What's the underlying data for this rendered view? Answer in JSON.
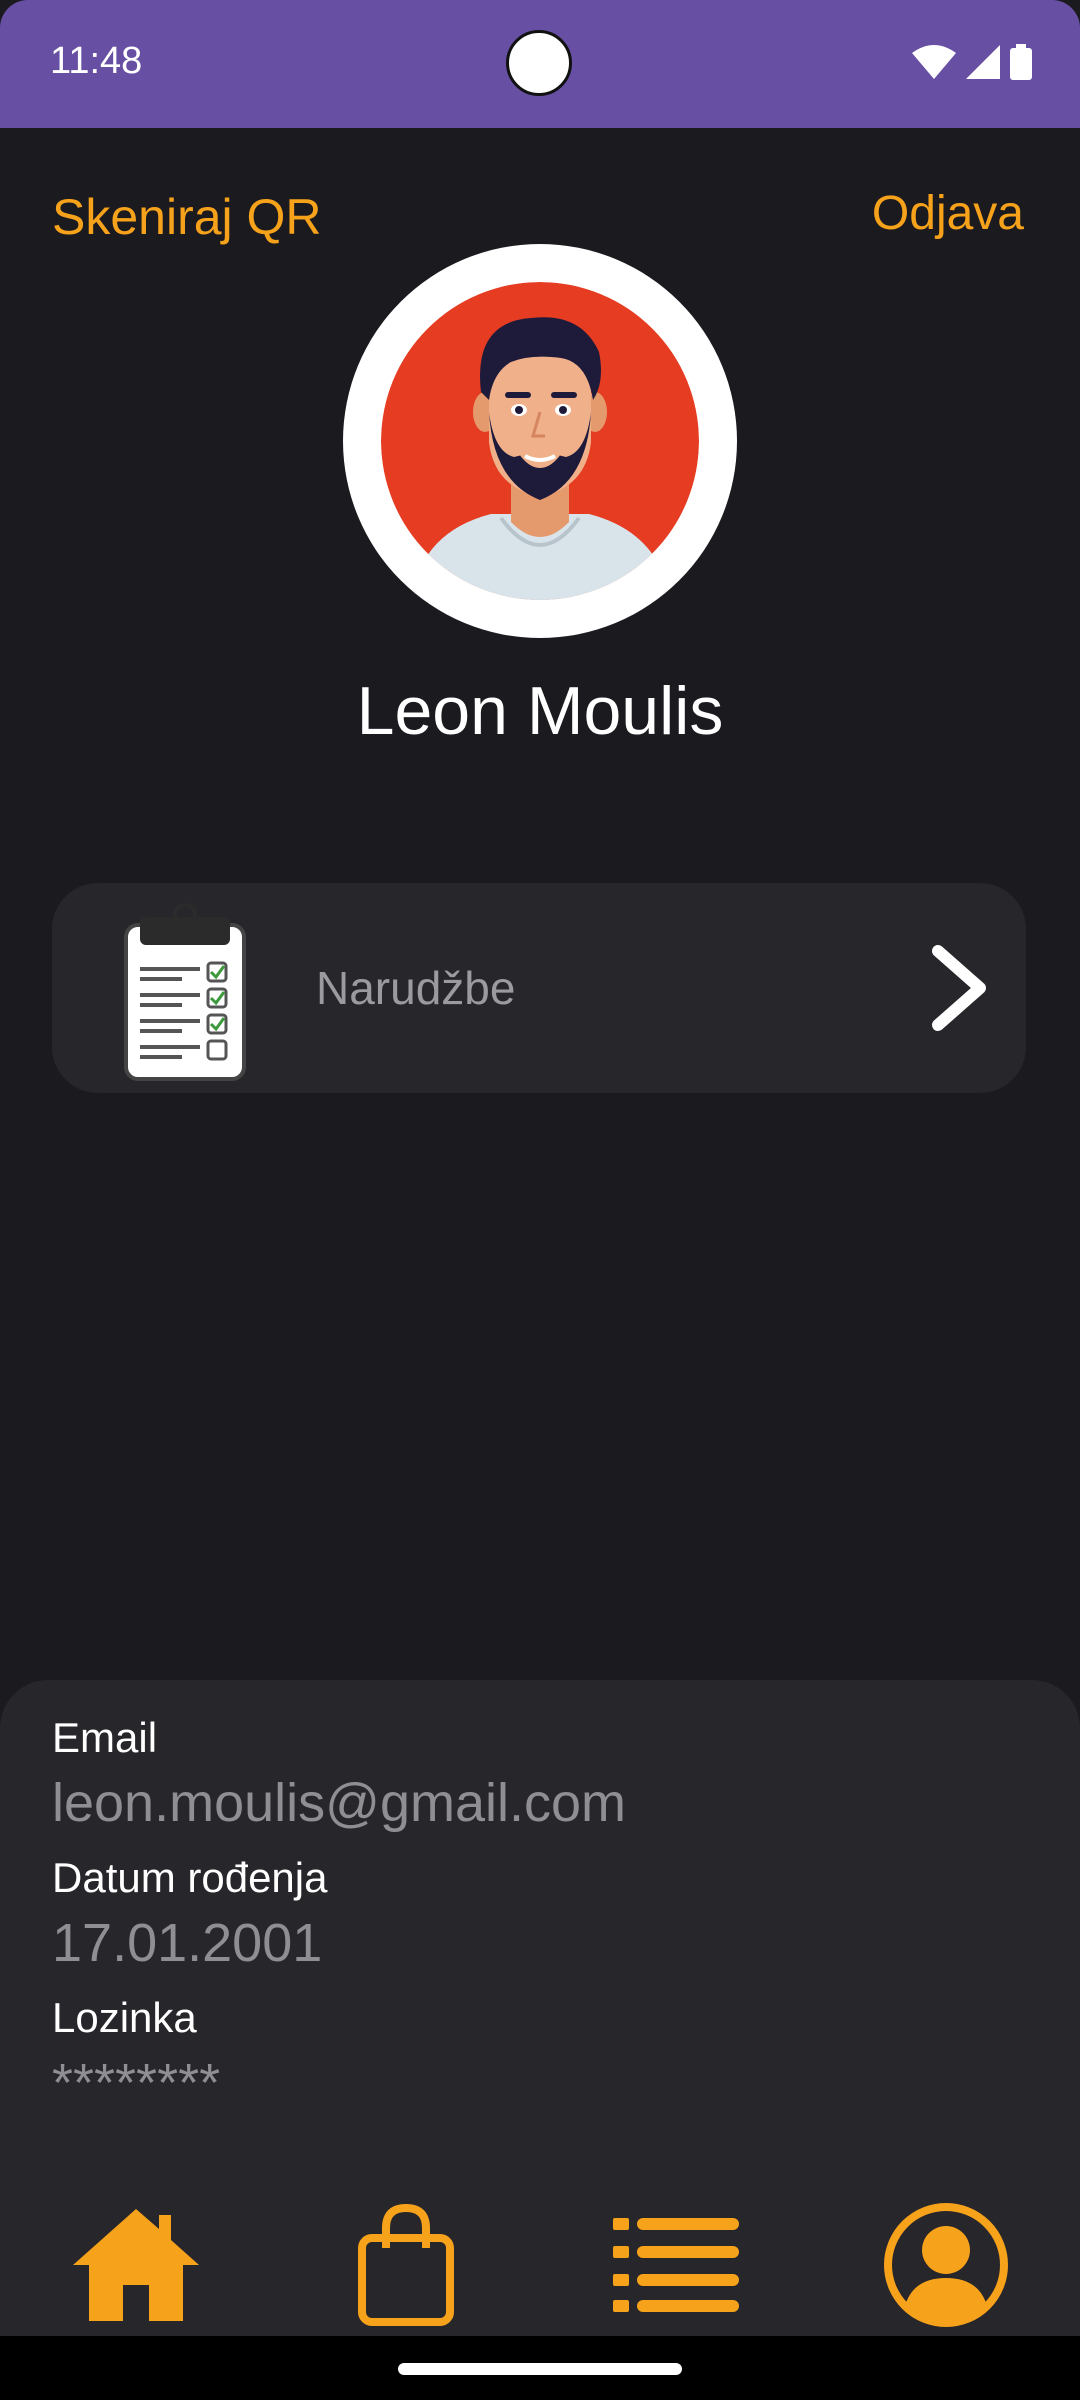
{
  "status_bar": {
    "time": "11:48"
  },
  "header": {
    "scan_qr_label": "Skeniraj QR",
    "logout_label": "Odjava"
  },
  "profile": {
    "name": "Leon Moulis"
  },
  "orders": {
    "label": "Narudžbe"
  },
  "info": {
    "email_label": "Email",
    "email_value": "leon.moulis@gmail.com",
    "birth_label": "Datum rođenja",
    "birth_value": "17.01.2001",
    "password_label": "Lozinka",
    "password_value": "********"
  },
  "nav": {
    "items": [
      "home-icon",
      "shopping-bag-icon",
      "list-icon",
      "profile-icon"
    ]
  },
  "colors": {
    "accent": "#f7a21b",
    "status_bar": "#6750a4",
    "background": "#1b1a1f",
    "card": "#27262b"
  }
}
